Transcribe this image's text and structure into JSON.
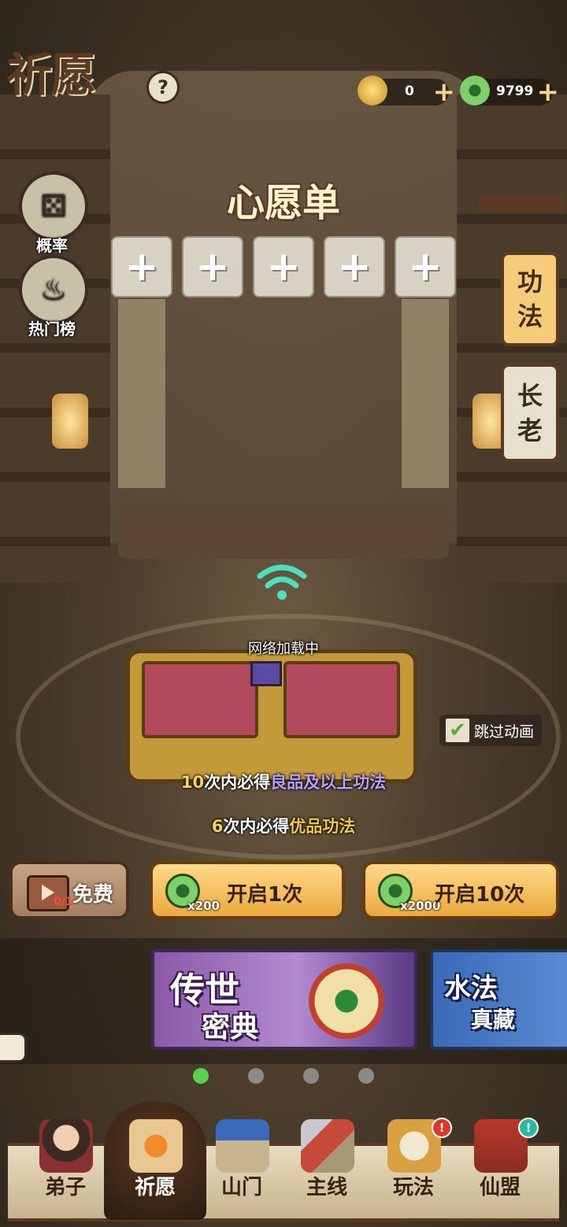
{
  "header": {
    "title": "祈愿",
    "help_label": "?",
    "resources": [
      {
        "icon": "key-icon",
        "value": "0"
      },
      {
        "icon": "jade-coin-icon",
        "value": "9799"
      }
    ],
    "plus_label": "+"
  },
  "side_buttons": [
    {
      "icon": "dice-icon",
      "label": "概率"
    },
    {
      "icon": "flame-scroll-icon",
      "label": "热门榜"
    }
  ],
  "wishlist": {
    "title": "心愿单",
    "slot_label": "+",
    "slots": 5
  },
  "right_tabs": [
    {
      "label_1": "功",
      "label_2": "法",
      "active": true
    },
    {
      "label_1": "长",
      "label_2": "老",
      "active": false
    }
  ],
  "chest": {
    "loading_text": "网络加载中"
  },
  "skip_animation": {
    "label": "跳过动画",
    "checked": true
  },
  "guarantees": [
    {
      "count": "10",
      "mid": "次内必得",
      "highlight": "良品及以上功法"
    },
    {
      "count": "6",
      "mid": "次内必得",
      "highlight": "优品功法"
    }
  ],
  "actions": {
    "free": {
      "label": "免费",
      "count": "0/1"
    },
    "one": {
      "label": "开启1次",
      "cost": "x200"
    },
    "ten": {
      "label": "开启10次",
      "cost": "x2000"
    }
  },
  "banners": [
    {
      "line1": "传世",
      "line2": "密典"
    },
    {
      "line1": "水法",
      "line2": "真藏"
    }
  ],
  "carousel": {
    "total": 4,
    "current": 1
  },
  "nav": [
    {
      "label": "弟子",
      "icon": "disciple-icon",
      "active": false,
      "alert": false
    },
    {
      "label": "祈愿",
      "icon": "wish-scroll-icon",
      "active": true,
      "alert": false
    },
    {
      "label": "山门",
      "icon": "gate-icon",
      "active": false,
      "alert": false
    },
    {
      "label": "主线",
      "icon": "sword-mountain-icon",
      "active": false,
      "alert": false
    },
    {
      "label": "玩法",
      "icon": "gameplay-icon",
      "active": false,
      "alert": true
    },
    {
      "label": "仙盟",
      "icon": "alliance-icon",
      "active": false,
      "alert": true
    }
  ],
  "colors": {
    "accent_gold": "#f5cd7a",
    "jade_green": "#5ad050",
    "alert_red": "#e0352a",
    "alert_teal": "#2ab8a0"
  }
}
